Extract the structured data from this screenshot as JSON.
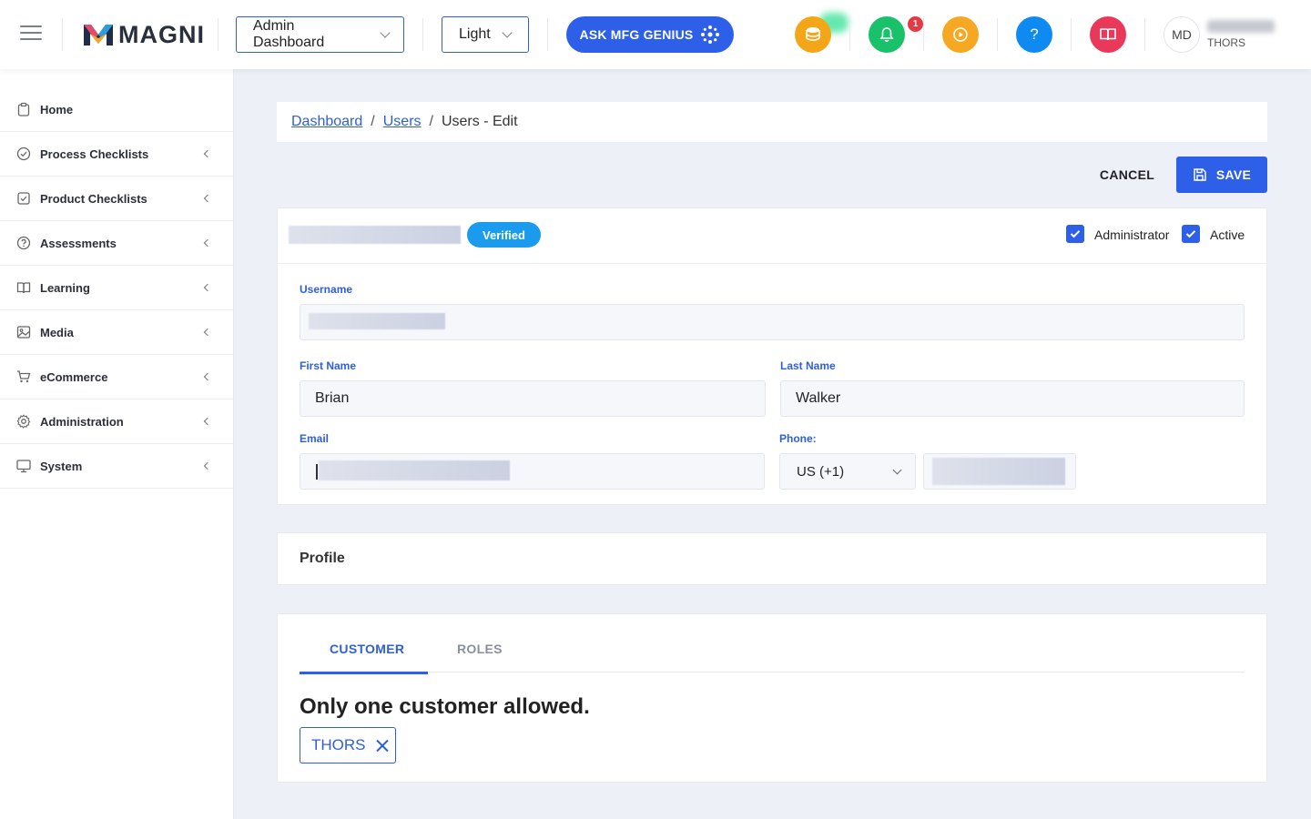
{
  "header": {
    "logo_text": "MAGNI",
    "dashboard_select": "Admin Dashboard",
    "theme_select": "Light",
    "ask_button": "ASK MFG GENIUS",
    "notification_count": "1",
    "help_label": "?",
    "user_initials": "MD",
    "user_org": "THORS"
  },
  "sidebar": {
    "items": [
      {
        "label": "Home",
        "icon": "clipboard-icon"
      },
      {
        "label": "Process Checklists",
        "icon": "check-circle-icon"
      },
      {
        "label": "Product Checklists",
        "icon": "check-square-icon"
      },
      {
        "label": "Assessments",
        "icon": "question-circle-icon"
      },
      {
        "label": "Learning",
        "icon": "book-icon"
      },
      {
        "label": "Media",
        "icon": "image-icon"
      },
      {
        "label": "eCommerce",
        "icon": "cart-icon"
      },
      {
        "label": "Administration",
        "icon": "gear-icon"
      },
      {
        "label": "System",
        "icon": "monitor-icon"
      }
    ]
  },
  "breadcrumb": {
    "dashboard": "Dashboard",
    "users": "Users",
    "current": "Users - Edit",
    "sep": "/"
  },
  "actions": {
    "cancel": "CANCEL",
    "save": "SAVE"
  },
  "user_form": {
    "verified_badge": "Verified",
    "administrator_label": "Administrator",
    "active_label": "Active",
    "username_label": "Username",
    "first_name_label": "First Name",
    "first_name_value": "Brian",
    "last_name_label": "Last Name",
    "last_name_value": "Walker",
    "email_label": "Email",
    "phone_label": "Phone:",
    "phone_country": "US (+1)"
  },
  "profile": {
    "label": "Profile"
  },
  "tabs": {
    "customer": "CUSTOMER",
    "roles": "ROLES",
    "note": "Only one customer allowed.",
    "chip": "THORS"
  },
  "colors": {
    "accent": "#2d5fe8",
    "coin": "#f2a618",
    "bell": "#18c16a",
    "play": "#f7a823",
    "help": "#0f8af0",
    "book": "#e9385a",
    "verified": "#1a9bee"
  }
}
